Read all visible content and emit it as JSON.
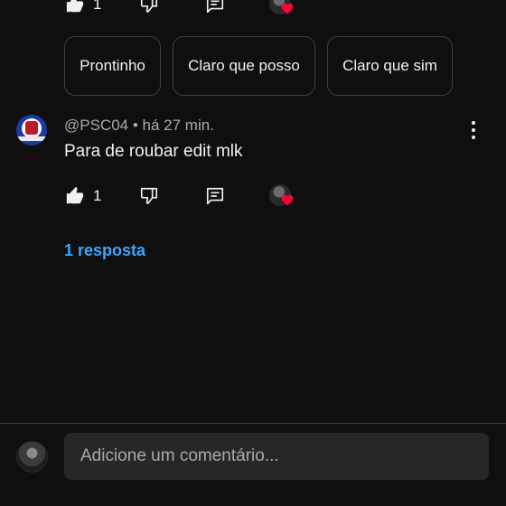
{
  "top_actions": {
    "like_count": "1"
  },
  "chips": [
    {
      "label": "Prontinho"
    },
    {
      "label": "Claro que posso"
    },
    {
      "label": "Claro que sim"
    }
  ],
  "comment": {
    "author": "@PSC04",
    "separator": "•",
    "time": "há 27 min.",
    "text": "Para de roubar edit mlk",
    "like_count": "1",
    "replies_label": "1 resposta"
  },
  "composer": {
    "placeholder": "Adicione um comentário..."
  },
  "colors": {
    "background": "#0f0f0f",
    "link": "#3ea6ff",
    "heart": "#ff0033",
    "input_bg": "#272727"
  },
  "icons": [
    "thumbs-up-icon",
    "thumbs-down-icon",
    "reply-icon",
    "heart-icon",
    "more-vert-icon"
  ]
}
